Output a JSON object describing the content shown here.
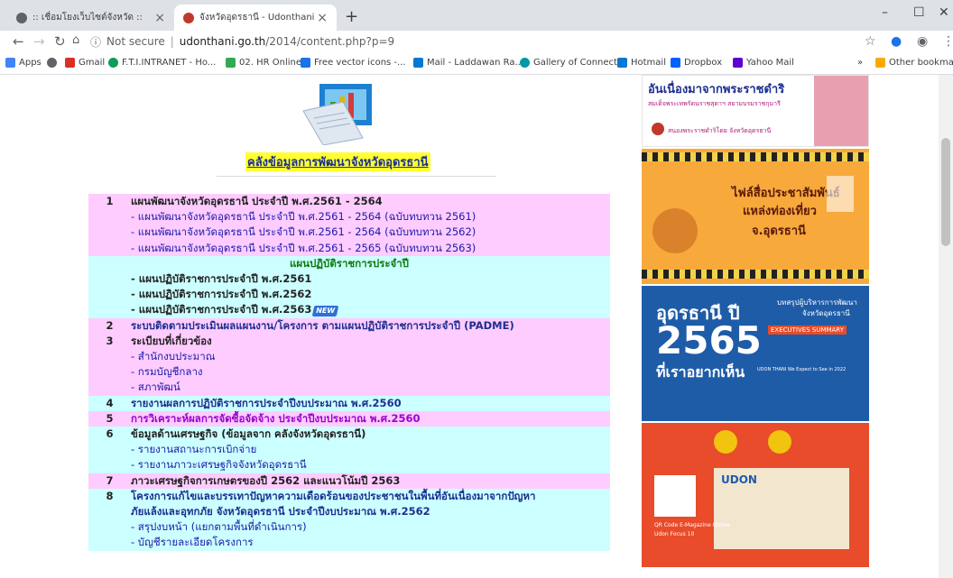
{
  "tabs": [
    {
      "title": ":: เชื่อมโยงเว็บไซต์จังหวัด ::",
      "active": false
    },
    {
      "title": "จังหวัดอุดรธานี - Udonthani",
      "active": true
    }
  ],
  "address": {
    "security": "Not secure",
    "host": "udonthani.go.th",
    "path": "/2014/content.php?p=9"
  },
  "bookmarks": [
    {
      "label": "Apps",
      "color": "#4285f4"
    },
    {
      "label": "",
      "color": "#5f6368"
    },
    {
      "label": "Gmail",
      "color": "#d93025"
    },
    {
      "label": "F.T.I.INTRANET - Ho...",
      "color": "#0f9d58"
    },
    {
      "label": "02. HR Online",
      "color": "#34a853"
    },
    {
      "label": "Free vector icons -...",
      "color": "#1a73e8"
    },
    {
      "label": "Mail - Laddawan Ra...",
      "color": "#0078d4"
    },
    {
      "label": "Gallery of Connect...",
      "color": "#0097a7"
    },
    {
      "label": "Hotmail",
      "color": "#0078d4"
    },
    {
      "label": "Dropbox",
      "color": "#0061fe"
    },
    {
      "label": "Yahoo Mail",
      "color": "#6001d2"
    },
    {
      "label": "»",
      "color": "#ffffff"
    },
    {
      "label": "Other bookmarks",
      "color": "#f9ab00"
    }
  ],
  "page": {
    "heading": "คลังข้อมูลการพัฒนาจังหวัดอุดรธานี",
    "rows": [
      {
        "num": "1",
        "text": "แผนพัฒนาจังหวัดอุดรธานี ประจำปี พ.ศ.2561 - 2564",
        "style": "b",
        "bg": "pink"
      },
      {
        "num": "",
        "text": "- แผนพัฒนาจังหวัดอุดรธานี ประจำปี พ.ศ.2561 - 2564 (ฉบับทบทวน 2561)",
        "style": "blue",
        "bg": "pink"
      },
      {
        "num": "",
        "text": "- แผนพัฒนาจังหวัดอุดรธานี ประจำปี พ.ศ.2561 - 2564 (ฉบับทบทวน 2562)",
        "style": "blue",
        "bg": "pink"
      },
      {
        "num": "",
        "text": "- แผนพัฒนาจังหวัดอุดรธานี ประจำปี พ.ศ.2561 - 2565 (ฉบับทบทวน 2563)",
        "style": "blue",
        "bg": "pink"
      },
      {
        "num": "",
        "text": "แผนปฏิบัติราชการประจำปี",
        "style": "green center",
        "bg": "cyan"
      },
      {
        "num": "",
        "text": "- แผนปฏิบัติราชการประจำปี พ.ศ.2561",
        "style": "b",
        "bg": "cyan"
      },
      {
        "num": "",
        "text": "- แผนปฏิบัติราชการประจำปี พ.ศ.2562",
        "style": "b",
        "bg": "cyan"
      },
      {
        "num": "",
        "text": "- แผนปฏิบัติราชการประจำปี พ.ศ.2563",
        "style": "b",
        "bg": "cyan",
        "badge": "NEW"
      },
      {
        "num": "2",
        "text": "ระบบติดตามประเมินผลแผนงาน/โครงการ ตามแผนปฏิบัติราชการประจำปี (PADME)",
        "style": "darkblue",
        "bg": "pink"
      },
      {
        "num": "3",
        "text": "ระเบียบที่เกี่ยวข้อง",
        "style": "b",
        "bg": "pink"
      },
      {
        "num": "",
        "text": "- สำนักงบประมาณ",
        "style": "blue",
        "bg": "pink"
      },
      {
        "num": "",
        "text": "- กรมบัญชีกลาง",
        "style": "blue",
        "bg": "pink"
      },
      {
        "num": "",
        "text": "- สภาพัฒน์",
        "style": "blue",
        "bg": "pink"
      },
      {
        "num": "4",
        "text": "รายงานผลการปฏิบัติราชการประจำปีงบประมาณ พ.ศ.2560",
        "style": "darkblue",
        "bg": "cyan"
      },
      {
        "num": "5",
        "text": "การวิเคราะห์ผลการจัดซื้อจัดจ้าง ประจำปีงบประมาณ พ.ศ.2560",
        "style": "purple",
        "bg": "pink"
      },
      {
        "num": "6",
        "text": "ข้อมูลด้านเศรษฐกิจ (ข้อมูลจาก คลังจังหวัดอุดรธานี)",
        "style": "b",
        "bg": "cyan"
      },
      {
        "num": "",
        "text": "- รายงานสถานะการเบิกจ่าย",
        "style": "blue",
        "bg": "cyan"
      },
      {
        "num": "",
        "text": "- รายงานภาวะเศรษฐกิจจังหวัดอุดรธานี",
        "style": "blue",
        "bg": "cyan"
      },
      {
        "num": "7",
        "text": "ภาวะเศรษฐกิจการเกษตรของปี 2562 และแนวโน้มปี 2563",
        "style": "b",
        "bg": "pink"
      },
      {
        "num": "8",
        "text": "โครงการแก้ไขและบรรเทาปัญหาความเดือดร้อนของประชาชนในพื้นที่อันเนื่องมาจากปัญหา",
        "style": "darkblue",
        "bg": "cyan"
      },
      {
        "num": "",
        "text": "ภัยแล้งและอุทกภัย จังหวัดอุดรธานี ประจำปีงบประมาณ พ.ศ.2562",
        "style": "darkblue",
        "bg": "cyan"
      },
      {
        "num": "",
        "text": "- สรุปงบหน้า (แยกตามพื้นที่ดำเนินการ)",
        "style": "blue",
        "bg": "cyan"
      },
      {
        "num": "",
        "text": "- บัญชีรายละเอียดโครงการ",
        "style": "blue",
        "bg": "cyan"
      }
    ]
  },
  "banners": {
    "b1_title": "อันเนื่องมาจากพระราชดำริ",
    "b1_sub": "สมเด็จพระเทพรัตนราชสุดาฯ สยามบรมราชกุมารี",
    "b1_org": "สนองพระราชดำริโดย จังหวัดอุดรธานี",
    "b2_line1": "ไฟล์สื่อประชาสัมพันธ์",
    "b2_line2": "แหล่งท่องเที่ยว",
    "b2_line3": "จ.อุดรธานี",
    "b3_title": "อุดรธานี ปี",
    "b3_year": "2565",
    "b3_sub": "ที่เราอยากเห็น",
    "b3_right1": "บทสรุปผู้บริหารการพัฒนา",
    "b3_right2": "จังหวัดอุดรธานี",
    "b3_badge": "EXECUTIVES SUMMARY",
    "b3_small": "UDON THANI We Expect to See in 2022",
    "b4_caption1": "QR Code E-Magazine Online",
    "b4_caption2": "Udon Focus 10",
    "b4_logo": "UDON"
  },
  "colors": {
    "heading_bg": "#ffff33",
    "pink": "#ffccff",
    "cyan": "#ccffff"
  }
}
